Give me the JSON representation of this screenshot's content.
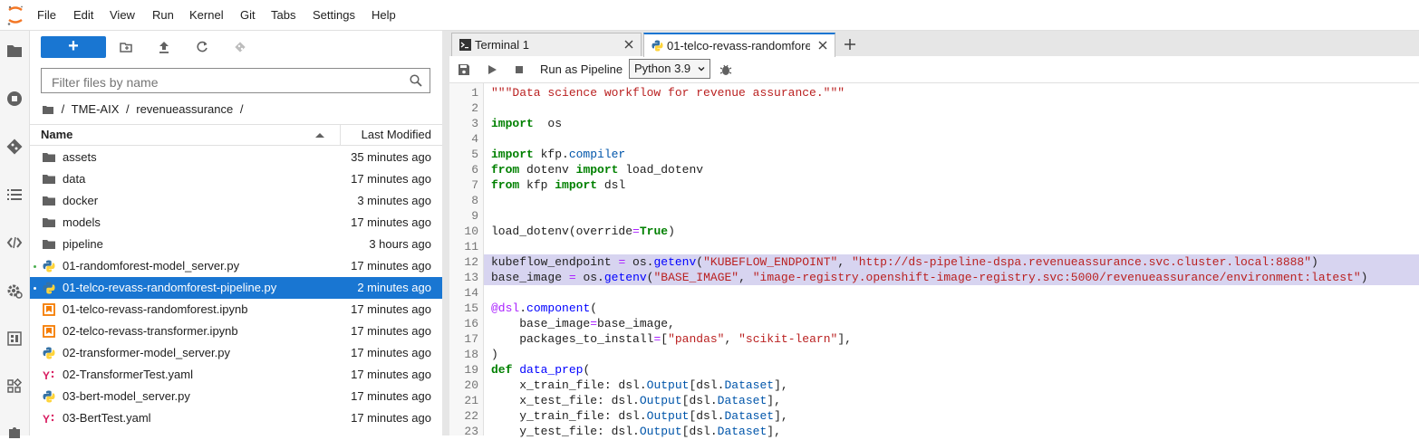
{
  "menubar": {
    "items": [
      "File",
      "Edit",
      "View",
      "Run",
      "Kernel",
      "Git",
      "Tabs",
      "Settings",
      "Help"
    ]
  },
  "activity_bar": {
    "icons": [
      "folder-icon",
      "running-icon",
      "git-icon",
      "toc-icon",
      "code-icon",
      "settings-gear-icon",
      "property-inspector-icon",
      "extensions-icon",
      "puzzle-icon"
    ]
  },
  "filebrowser": {
    "new_label": "+",
    "filter_placeholder": "Filter files by name",
    "breadcrumb": [
      "/",
      "TME-AIX",
      "/",
      "revenueassurance",
      "/"
    ],
    "header_name": "Name",
    "header_modified": "Last Modified",
    "rows": [
      {
        "name": "assets",
        "time": "35 minutes ago",
        "icon": "folder"
      },
      {
        "name": "data",
        "time": "17 minutes ago",
        "icon": "folder"
      },
      {
        "name": "docker",
        "time": "3 minutes ago",
        "icon": "folder"
      },
      {
        "name": "models",
        "time": "17 minutes ago",
        "icon": "folder"
      },
      {
        "name": "pipeline",
        "time": "3 hours ago",
        "icon": "folder"
      },
      {
        "name": "01-randomforest-model_server.py",
        "time": "17 minutes ago",
        "icon": "python",
        "dot": true
      },
      {
        "name": "01-telco-revass-randomforest-pipeline.py",
        "time": "2 minutes ago",
        "icon": "python",
        "dot": true,
        "selected": true
      },
      {
        "name": "01-telco-revass-randomforest.ipynb",
        "time": "17 minutes ago",
        "icon": "notebook"
      },
      {
        "name": "02-telco-revass-transformer.ipynb",
        "time": "17 minutes ago",
        "icon": "notebook"
      },
      {
        "name": "02-transformer-model_server.py",
        "time": "17 minutes ago",
        "icon": "python"
      },
      {
        "name": "02-TransformerTest.yaml",
        "time": "17 minutes ago",
        "icon": "yaml"
      },
      {
        "name": "03-bert-model_server.py",
        "time": "17 minutes ago",
        "icon": "python"
      },
      {
        "name": "03-BertTest.yaml",
        "time": "17 minutes ago",
        "icon": "yaml"
      }
    ]
  },
  "tabs": [
    {
      "label": "Terminal 1",
      "icon": "terminal"
    },
    {
      "label": "01-telco-revass-randomfore",
      "icon": "python",
      "active": true
    }
  ],
  "toolbar": {
    "run_as_pipeline": "Run as Pipeline",
    "kernel": "Python 3.9"
  },
  "editor": {
    "line_numbers": [
      "1",
      "2",
      "3",
      "4",
      "5",
      "6",
      "7",
      "8",
      "9",
      "10",
      "11",
      "12",
      "13",
      "14",
      "15",
      "16",
      "17",
      "18",
      "19",
      "20",
      "21",
      "22",
      "23"
    ],
    "highlighted_lines": [
      12,
      13
    ],
    "lines": [
      [
        [
          "st",
          "\"\"\"Data science workflow for revenue assurance.\"\"\""
        ]
      ],
      [],
      [
        [
          "kw",
          "import"
        ],
        [
          "",
          "  os"
        ]
      ],
      [],
      [
        [
          "kw",
          "import"
        ],
        [
          "",
          " kfp."
        ],
        [
          "nm2",
          "compiler"
        ]
      ],
      [
        [
          "kw",
          "from"
        ],
        [
          "",
          " dotenv "
        ],
        [
          "kw",
          "import"
        ],
        [
          "",
          " load_dotenv"
        ]
      ],
      [
        [
          "kw",
          "from"
        ],
        [
          "",
          " kfp "
        ],
        [
          "kw",
          "import"
        ],
        [
          "",
          " dsl"
        ]
      ],
      [],
      [],
      [
        [
          "",
          "load_dotenv(override"
        ],
        [
          "op",
          "="
        ],
        [
          "cst",
          "True"
        ],
        [
          "",
          ")"
        ]
      ],
      [],
      [
        [
          "",
          "kubeflow_endpoint "
        ],
        [
          "op",
          "="
        ],
        [
          "",
          " os."
        ],
        [
          "fn",
          "getenv"
        ],
        [
          "",
          "("
        ],
        [
          "st",
          "\"KUBEFLOW_ENDPOINT\""
        ],
        [
          "",
          ", "
        ],
        [
          "st",
          "\"http://ds-pipeline-dspa.revenueassurance.svc.cluster.local:8888\""
        ],
        [
          "",
          ")"
        ]
      ],
      [
        [
          "",
          "base_image "
        ],
        [
          "op",
          "="
        ],
        [
          "",
          " os."
        ],
        [
          "fn",
          "getenv"
        ],
        [
          "",
          "("
        ],
        [
          "st",
          "\"BASE_IMAGE\""
        ],
        [
          "",
          ", "
        ],
        [
          "st",
          "\"image-registry.openshift-image-registry.svc:5000/revenueassurance/environment:latest\""
        ],
        [
          "",
          ")"
        ]
      ],
      [],
      [
        [
          "dec",
          "@dsl"
        ],
        [
          "",
          "."
        ],
        [
          "fn",
          "component"
        ],
        [
          "",
          "("
        ]
      ],
      [
        [
          "",
          "    base_image"
        ],
        [
          "op",
          "="
        ],
        [
          "",
          "base_image,"
        ]
      ],
      [
        [
          "",
          "    packages_to_install"
        ],
        [
          "op",
          "="
        ],
        [
          "",
          "["
        ],
        [
          "st",
          "\"pandas\""
        ],
        [
          "",
          ", "
        ],
        [
          "st",
          "\"scikit-learn\""
        ],
        [
          "",
          "],"
        ]
      ],
      [
        [
          "",
          ")"
        ]
      ],
      [
        [
          "kw",
          "def"
        ],
        [
          "",
          " "
        ],
        [
          "fn",
          "data_prep"
        ],
        [
          "",
          "("
        ]
      ],
      [
        [
          "",
          "    x_train_file: dsl."
        ],
        [
          "nm2",
          "Output"
        ],
        [
          "",
          "[dsl."
        ],
        [
          "nm2",
          "Dataset"
        ],
        [
          "",
          "],"
        ]
      ],
      [
        [
          "",
          "    x_test_file: dsl."
        ],
        [
          "nm2",
          "Output"
        ],
        [
          "",
          "[dsl."
        ],
        [
          "nm2",
          "Dataset"
        ],
        [
          "",
          "],"
        ]
      ],
      [
        [
          "",
          "    y_train_file: dsl."
        ],
        [
          "nm2",
          "Output"
        ],
        [
          "",
          "[dsl."
        ],
        [
          "nm2",
          "Dataset"
        ],
        [
          "",
          "],"
        ]
      ],
      [
        [
          "",
          "    y_test_file: dsl."
        ],
        [
          "nm2",
          "Output"
        ],
        [
          "",
          "[dsl."
        ],
        [
          "nm2",
          "Dataset"
        ],
        [
          "",
          "],"
        ]
      ]
    ]
  },
  "colors": {
    "accent": "#1976d2",
    "selection_highlight": "#d7d4f0",
    "logo_orange": "#f37726"
  }
}
